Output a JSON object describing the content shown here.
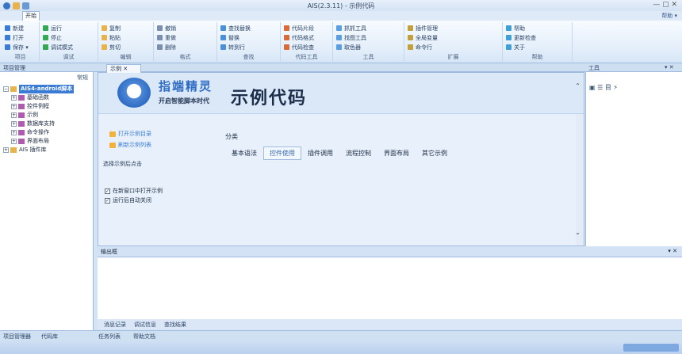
{
  "window": {
    "title": "AIS(2.3.11) - 示例代码",
    "controls": "— ▢ ✕"
  },
  "ribbon": {
    "app_tab": "开始",
    "right_label": "帮助 ▾",
    "groups": [
      {
        "name": "项目",
        "lines": [
          "新建",
          "打开",
          "保存 ▾"
        ]
      },
      {
        "name": "调试",
        "lines": [
          "运行",
          "停止",
          "调试模式"
        ]
      },
      {
        "name": "编辑",
        "lines": [
          "复制",
          "粘贴",
          "剪切"
        ]
      },
      {
        "name": "格式",
        "lines": [
          "撤销",
          "重做",
          "删除"
        ]
      },
      {
        "name": "查找",
        "lines": [
          "查找替换",
          "替换",
          "转到行"
        ]
      },
      {
        "name": "代码工具",
        "lines": [
          "代码片段",
          "代码格式",
          "代码检查"
        ]
      },
      {
        "name": "工具",
        "lines": [
          "抓抓工具",
          "找图工具",
          "取色器"
        ]
      },
      {
        "name": "扩展",
        "lines": [
          "插件管理",
          "全局变量",
          "命令行"
        ]
      },
      {
        "name": "帮助",
        "lines": [
          "帮助",
          "更新检查",
          "关于"
        ]
      }
    ]
  },
  "panes": {
    "project_header": "项目管理",
    "doc_tab": "示例 ✕",
    "right_header": "工具",
    "right_pin": "▾ ✕"
  },
  "project": {
    "subheader": "常规",
    "tree": [
      {
        "label": "AIS4-android脚本",
        "selected": true,
        "expander": "−"
      },
      {
        "label": "基础函数",
        "selected": false,
        "expander": "+"
      },
      {
        "label": "控件例程",
        "selected": false,
        "expander": "+"
      },
      {
        "label": "示例",
        "selected": false,
        "expander": "+"
      },
      {
        "label": "数据库支持",
        "selected": false,
        "expander": "+"
      },
      {
        "label": "命令操作",
        "selected": false,
        "expander": "+"
      },
      {
        "label": "界面布局",
        "selected": false,
        "expander": "+"
      },
      {
        "label": "AIS 插件库",
        "selected": false,
        "expander": "+"
      }
    ]
  },
  "editor": {
    "brand_name": "指端精灵",
    "brand_slogan": "开启智能脚本时代",
    "main_title": "示例代码",
    "links": [
      "打开示例目录",
      "刷新示例列表"
    ],
    "side_note": "选择示例后点击",
    "checkboxes": [
      "在新窗口中打开示例",
      "运行后自动关闭"
    ],
    "category_label": "分类",
    "category_tabs": [
      "基本语法",
      "控件使用",
      "插件调用",
      "流程控制",
      "界面布局",
      "其它示例"
    ],
    "active_tab": 1
  },
  "right_panel": {
    "tools": "▣ ☰ 目 ⚡"
  },
  "output": {
    "header": "输出框",
    "pin": "▾ ✕",
    "tabs": [
      "消息记录",
      "调试信息",
      "查找结果"
    ],
    "bottom_tabs": [
      "项目管理器",
      "代码库",
      "任务列表",
      "帮助文档"
    ]
  }
}
